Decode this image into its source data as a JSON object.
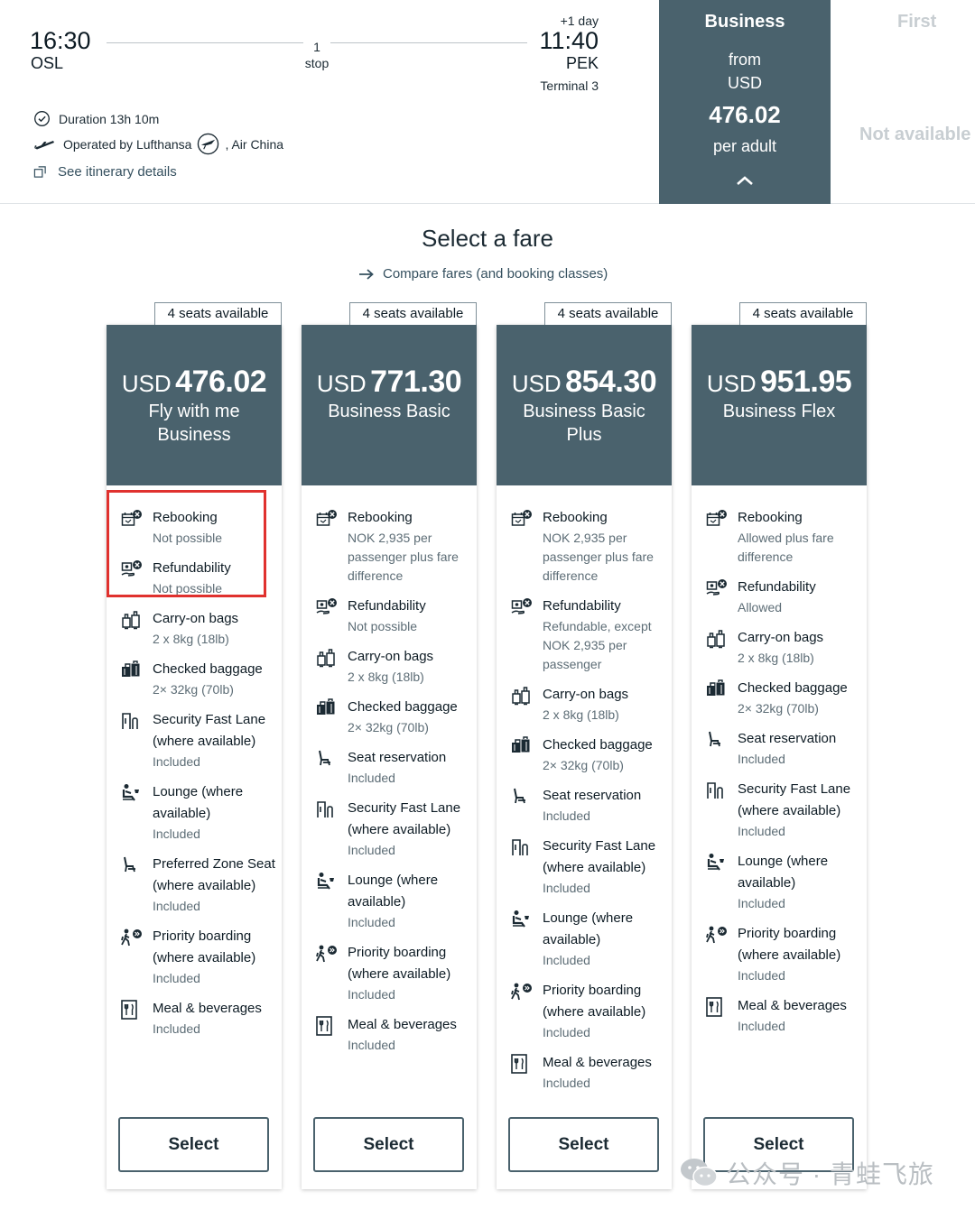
{
  "flight": {
    "departure_time": "16:30",
    "departure_code": "OSL",
    "stops_count": "1",
    "stops_label": "stop",
    "plus_day": "+1 day",
    "arrival_time": "11:40",
    "arrival_code": "PEK",
    "arrival_terminal": "Terminal 3",
    "duration": "Duration 13h 10m",
    "operated_by": "Operated by Lufthansa",
    "operated_by_2": ", Air China",
    "itinerary_link": "See itinerary details"
  },
  "cabins": {
    "business": {
      "title": "Business",
      "from": "from",
      "currency": "USD",
      "price": "476.02",
      "per": "per adult"
    },
    "first": {
      "title": "First",
      "status": "Not available"
    }
  },
  "select_fare": {
    "title": "Select a fare",
    "compare_link": "Compare fares (and booking classes)"
  },
  "fares": [
    {
      "seats": "4 seats available",
      "currency": "USD",
      "price": "476.02",
      "name": "Fly with me Business",
      "select_label": "Select",
      "features": [
        {
          "icon": "rebooking-icon",
          "title": "Rebooking",
          "sub": "Not possible"
        },
        {
          "icon": "refundability-icon",
          "title": "Refundability",
          "sub": "Not possible"
        },
        {
          "icon": "carry-on-bags-icon",
          "title": "Carry-on bags",
          "sub": "2 x 8kg (18lb)"
        },
        {
          "icon": "checked-baggage-icon",
          "title": "Checked baggage",
          "sub": "2× 32kg (70lb)"
        },
        {
          "icon": "security-fast-lane-icon",
          "title": "Security Fast Lane (where available)",
          "sub": "Included"
        },
        {
          "icon": "lounge-icon",
          "title": "Lounge (where available)",
          "sub": "Included"
        },
        {
          "icon": "seat-icon",
          "title": "Preferred Zone Seat (where available)",
          "sub": "Included"
        },
        {
          "icon": "priority-boarding-icon",
          "title": "Priority boarding (where available)",
          "sub": "Included"
        },
        {
          "icon": "meal-icon",
          "title": "Meal & beverages",
          "sub": "Included"
        }
      ]
    },
    {
      "seats": "4 seats available",
      "currency": "USD",
      "price": "771.30",
      "name": "Business Basic",
      "select_label": "Select",
      "features": [
        {
          "icon": "rebooking-icon",
          "title": "Rebooking",
          "sub": "NOK 2,935 per passenger plus fare difference"
        },
        {
          "icon": "refundability-icon",
          "title": "Refundability",
          "sub": "Not possible"
        },
        {
          "icon": "carry-on-bags-icon",
          "title": "Carry-on bags",
          "sub": "2 x 8kg (18lb)"
        },
        {
          "icon": "checked-baggage-icon",
          "title": "Checked baggage",
          "sub": "2× 32kg (70lb)"
        },
        {
          "icon": "seat-icon",
          "title": "Seat reservation",
          "sub": "Included"
        },
        {
          "icon": "security-fast-lane-icon",
          "title": "Security Fast Lane (where available)",
          "sub": "Included"
        },
        {
          "icon": "lounge-icon",
          "title": "Lounge (where available)",
          "sub": "Included"
        },
        {
          "icon": "priority-boarding-icon",
          "title": "Priority boarding (where available)",
          "sub": "Included"
        },
        {
          "icon": "meal-icon",
          "title": "Meal & beverages",
          "sub": "Included"
        }
      ]
    },
    {
      "seats": "4 seats available",
      "currency": "USD",
      "price": "854.30",
      "name": "Business Basic Plus",
      "select_label": "Select",
      "features": [
        {
          "icon": "rebooking-icon",
          "title": "Rebooking",
          "sub": "NOK 2,935 per passenger plus fare difference"
        },
        {
          "icon": "refundability-icon",
          "title": "Refundability",
          "sub": "Refundable, except NOK 2,935 per passenger"
        },
        {
          "icon": "carry-on-bags-icon",
          "title": "Carry-on bags",
          "sub": "2 x 8kg (18lb)"
        },
        {
          "icon": "checked-baggage-icon",
          "title": "Checked baggage",
          "sub": "2× 32kg (70lb)"
        },
        {
          "icon": "seat-icon",
          "title": "Seat reservation",
          "sub": "Included"
        },
        {
          "icon": "security-fast-lane-icon",
          "title": "Security Fast Lane (where available)",
          "sub": "Included"
        },
        {
          "icon": "lounge-icon",
          "title": "Lounge (where available)",
          "sub": "Included"
        },
        {
          "icon": "priority-boarding-icon",
          "title": "Priority boarding (where available)",
          "sub": "Included"
        },
        {
          "icon": "meal-icon",
          "title": "Meal & beverages",
          "sub": "Included"
        }
      ]
    },
    {
      "seats": "4 seats available",
      "currency": "USD",
      "price": "951.95",
      "name": "Business Flex",
      "select_label": "Select",
      "features": [
        {
          "icon": "rebooking-icon",
          "title": "Rebooking",
          "sub": "Allowed plus fare difference"
        },
        {
          "icon": "refundability-icon",
          "title": "Refundability",
          "sub": "Allowed"
        },
        {
          "icon": "carry-on-bags-icon",
          "title": "Carry-on bags",
          "sub": "2 x 8kg (18lb)"
        },
        {
          "icon": "checked-baggage-icon",
          "title": "Checked baggage",
          "sub": "2× 32kg (70lb)"
        },
        {
          "icon": "seat-icon",
          "title": "Seat reservation",
          "sub": "Included"
        },
        {
          "icon": "security-fast-lane-icon",
          "title": "Security Fast Lane (where available)",
          "sub": "Included"
        },
        {
          "icon": "lounge-icon",
          "title": "Lounge (where available)",
          "sub": "Included"
        },
        {
          "icon": "priority-boarding-icon",
          "title": "Priority boarding (where available)",
          "sub": "Included"
        },
        {
          "icon": "meal-icon",
          "title": "Meal & beverages",
          "sub": "Included"
        }
      ]
    }
  ],
  "watermark": {
    "text": "公众号 · 青蛙飞旅",
    "icon": "wechat-icon"
  },
  "colors": {
    "header_bg": "#4a626d",
    "highlight": "#e0312e",
    "disabled_text": "#c8ced2"
  }
}
